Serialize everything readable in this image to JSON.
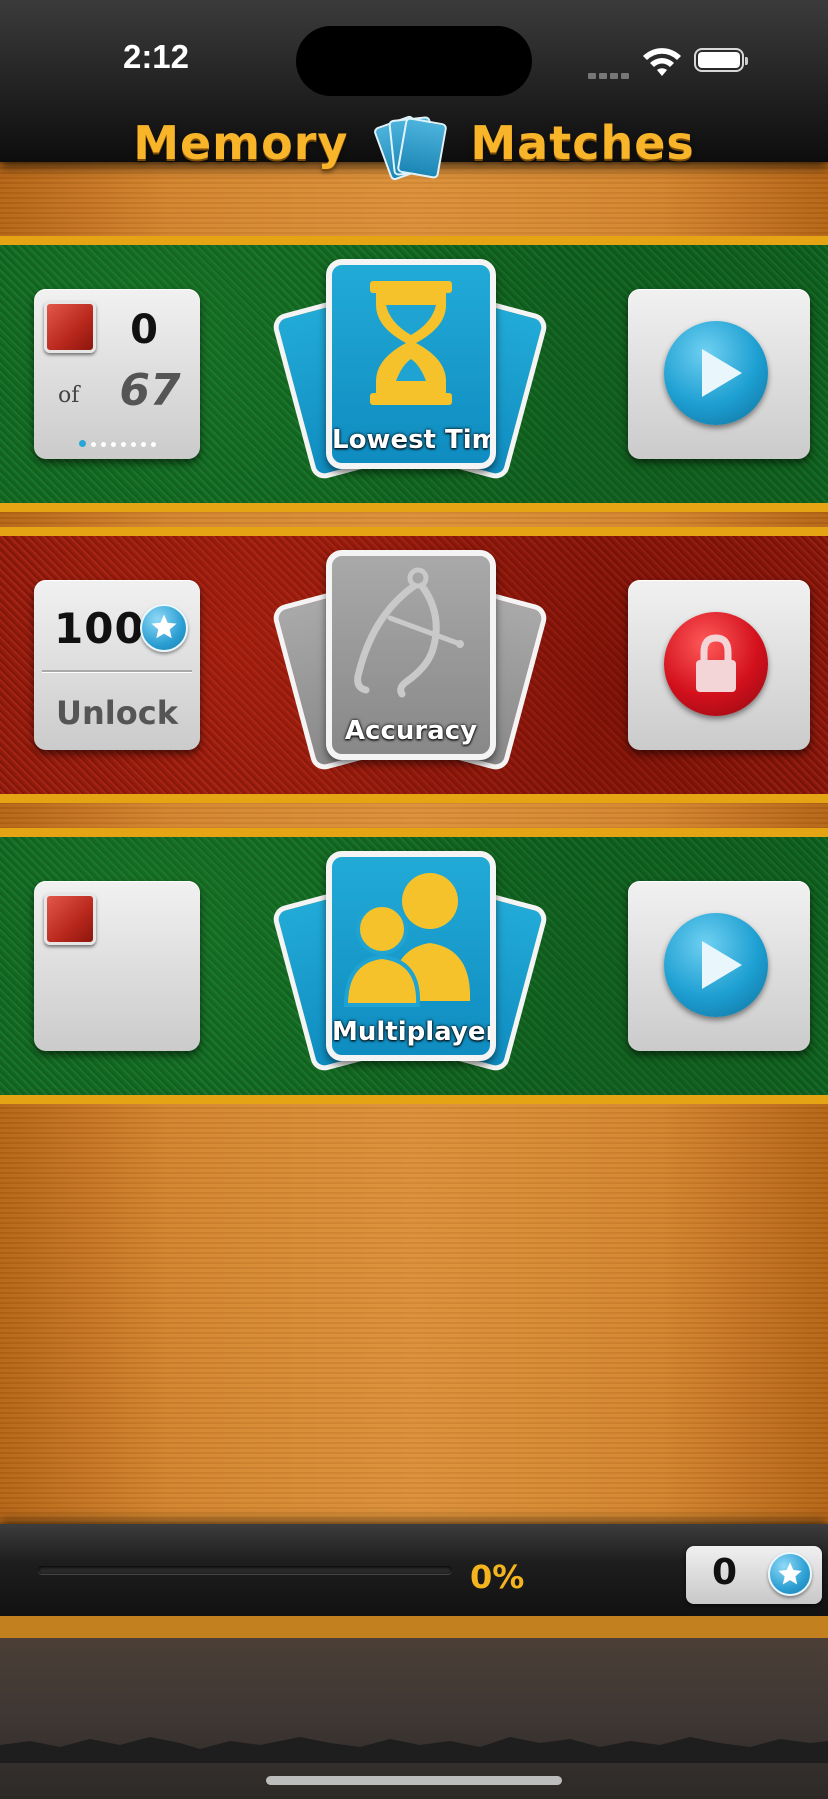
{
  "status_bar": {
    "time": "2:12"
  },
  "header": {
    "title_left": "Memory",
    "title_right": "Matches"
  },
  "modes": [
    {
      "label": "Lowest Time",
      "status": "unlocked",
      "score_current": "0",
      "score_of": "of",
      "score_total": "67",
      "page_dots": 8,
      "active_dot": 0
    },
    {
      "label": "Accuracy",
      "status": "locked",
      "unlock_cost": "100",
      "unlock_label": "Unlock"
    },
    {
      "label": "Multiplayer",
      "status": "unlocked"
    }
  ],
  "progress": {
    "value": 0,
    "percent_label": "0%"
  },
  "stars": {
    "count": "0"
  },
  "colors": {
    "accent_gold": "#f3b41f",
    "felt_green": "#15702a",
    "felt_red": "#a02414",
    "card_blue": "#1a9ccc",
    "play_blue": "#1d9fd2",
    "lock_red": "#d2101c"
  },
  "icons": [
    "hourglass-icon",
    "caliper-icon",
    "two-people-icon",
    "play-icon",
    "lock-icon",
    "star-icon",
    "wifi-icon",
    "battery-icon"
  ]
}
